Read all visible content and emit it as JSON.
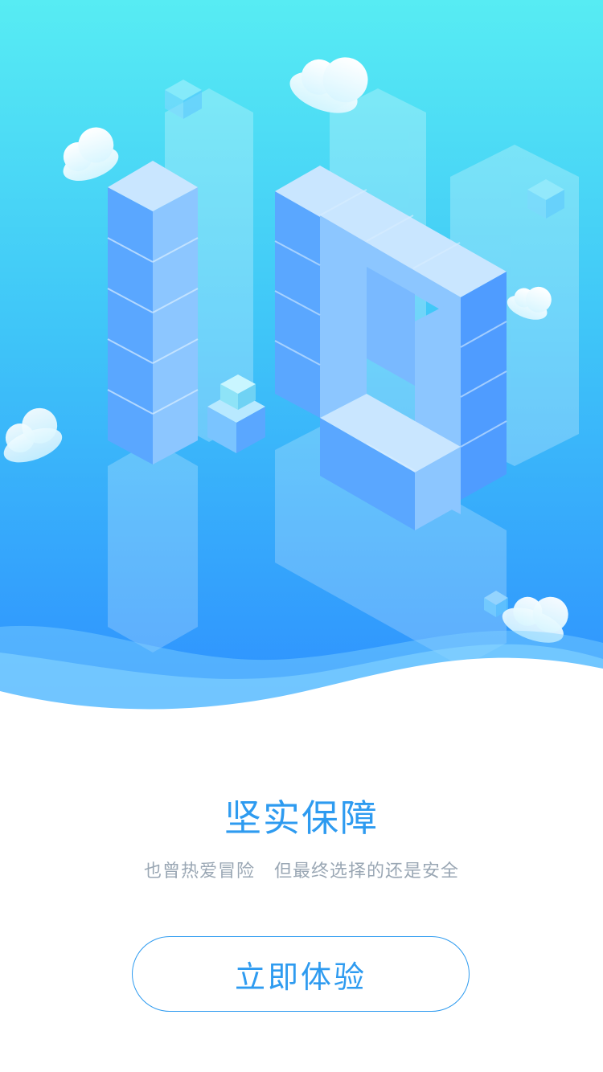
{
  "hero": {
    "illustration": "isometric-10-blocks",
    "colors": {
      "sky_top": "#55eaf2",
      "sky_bottom": "#2f8dff",
      "block_light": "#c9e6ff",
      "block_mid": "#8cc6ff",
      "block_dark": "#5aa7ff"
    }
  },
  "content": {
    "title": "坚实保障",
    "subtitle": "也曾热爱冒险   但最终选择的还是安全"
  },
  "cta": {
    "label": "立即体验",
    "color": "#2e9bf0"
  }
}
